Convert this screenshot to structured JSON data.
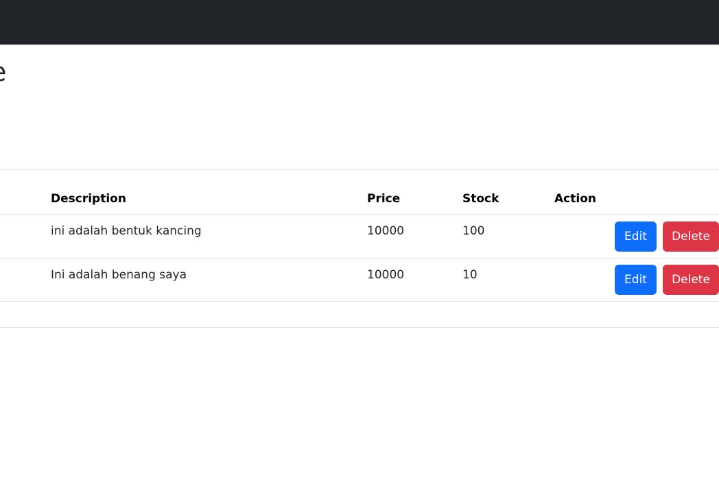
{
  "header": {
    "color": "#212529"
  },
  "page": {
    "title": "e"
  },
  "table": {
    "columns": {
      "description": "Description",
      "price": "Price",
      "stock": "Stock",
      "action": "Action"
    },
    "rows": [
      {
        "description": "ini adalah bentuk kancing",
        "price": "10000",
        "stock": "100",
        "edit_label": "Edit",
        "delete_label": "Delete"
      },
      {
        "description": "Ini adalah benang saya",
        "price": "10000",
        "stock": "10",
        "edit_label": "Edit",
        "delete_label": "Delete"
      }
    ]
  },
  "colors": {
    "edit": "#0d6efd",
    "delete": "#dc3545",
    "border": "#dee2e6"
  }
}
